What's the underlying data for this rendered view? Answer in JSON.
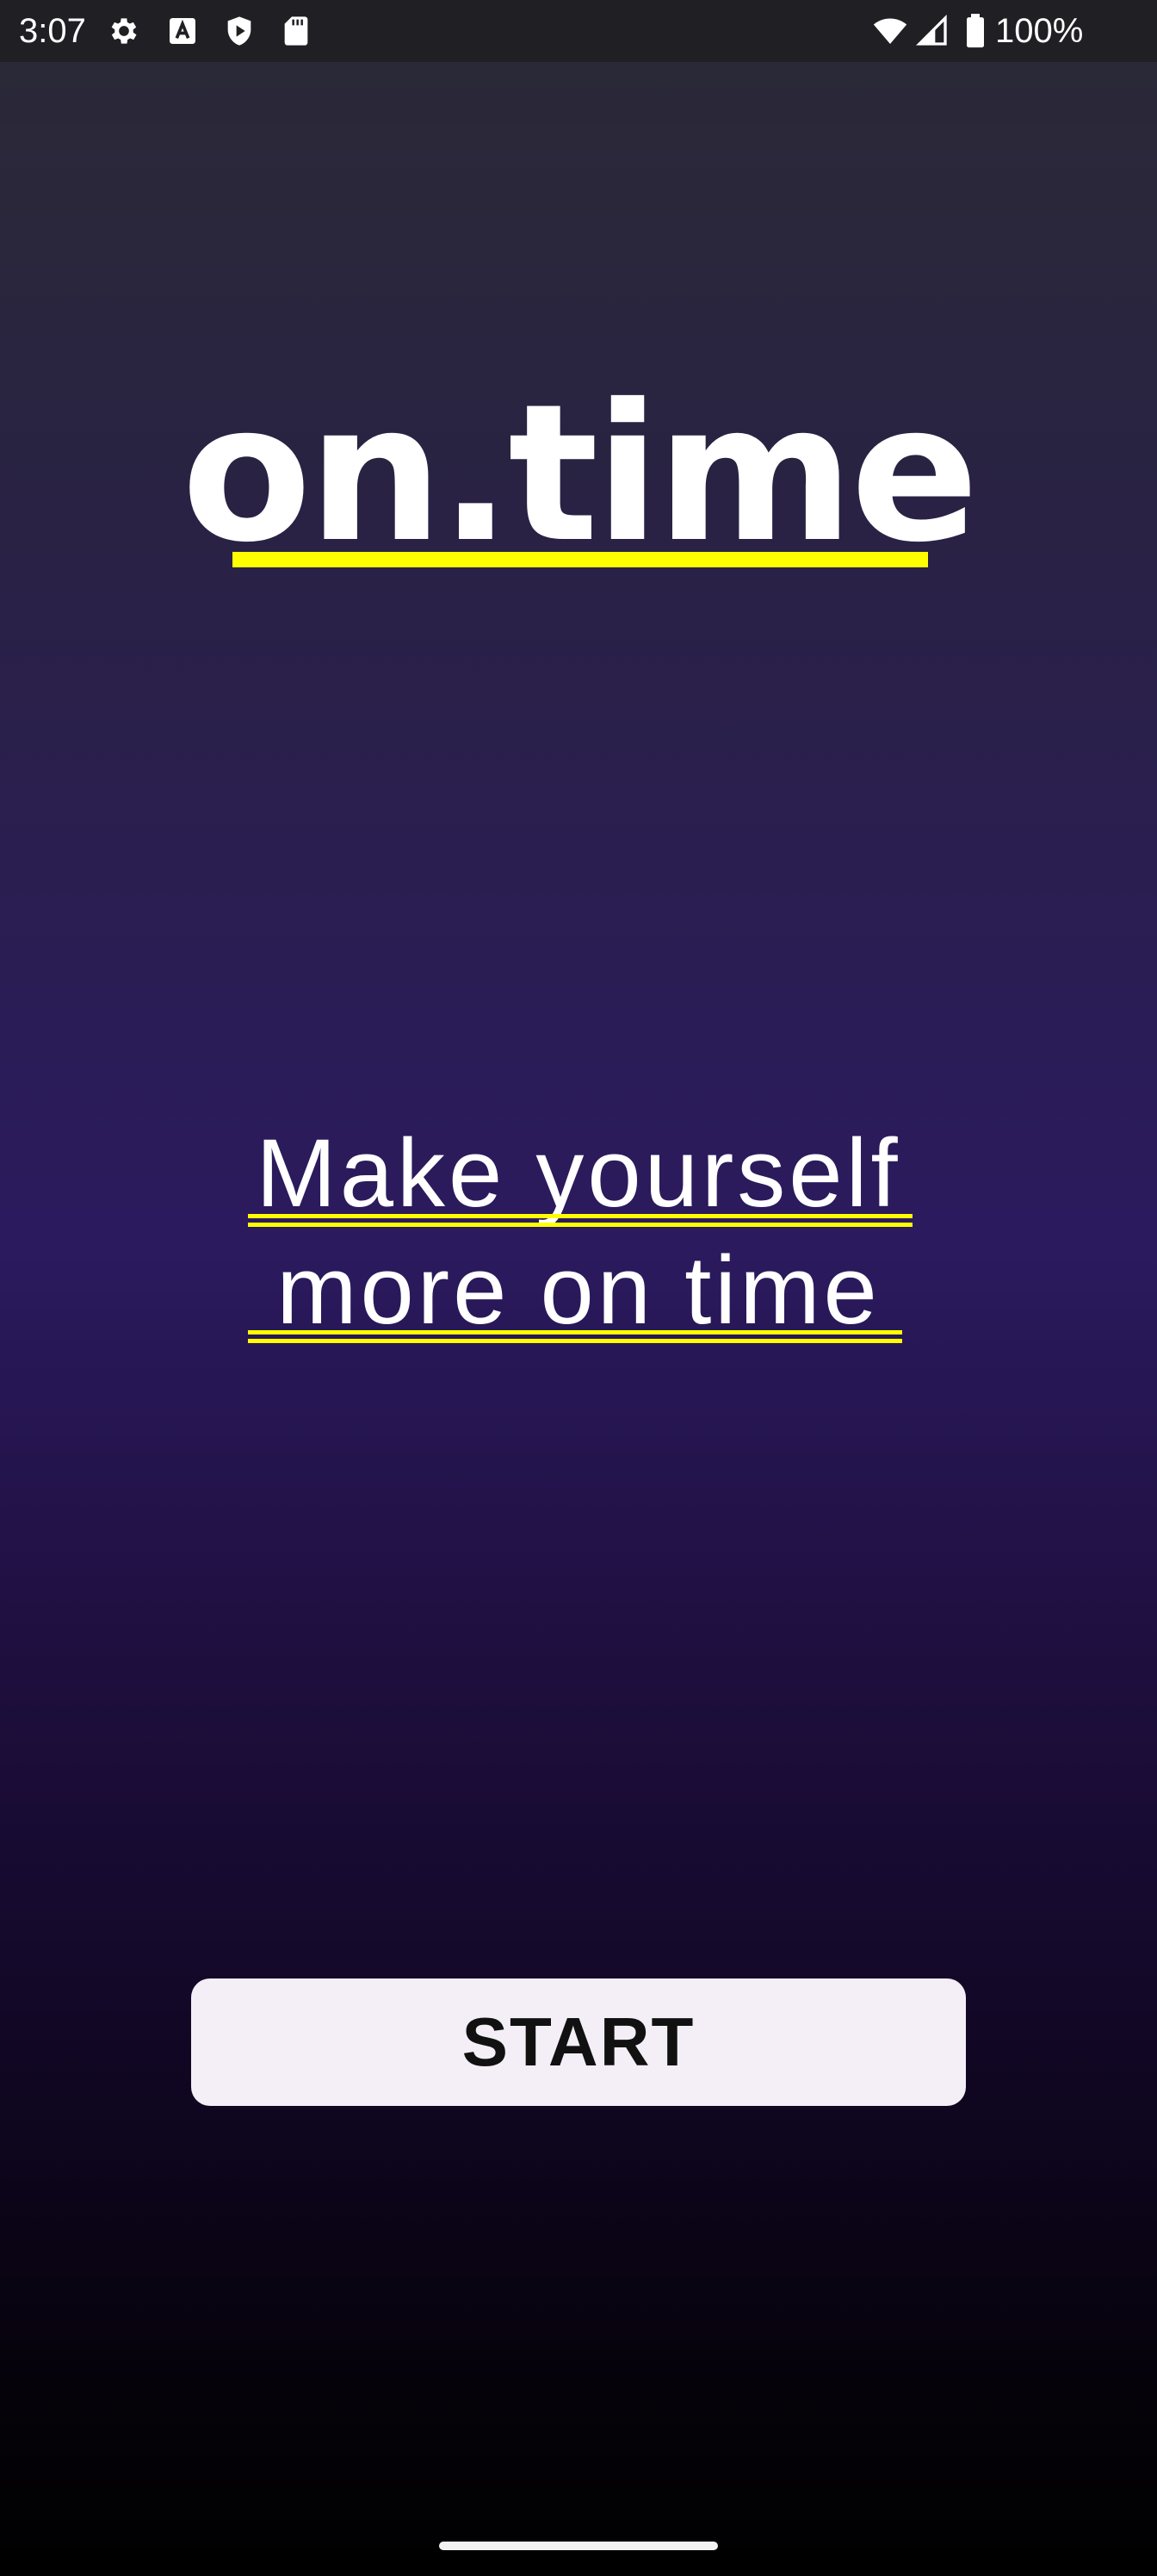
{
  "status_bar": {
    "time": "3:07",
    "battery_text": "100%",
    "icons": [
      "gear-icon",
      "a-box-icon",
      "shield-play-icon",
      "sd-card-icon",
      "wifi-icon",
      "signal-icon",
      "battery-icon"
    ]
  },
  "app": {
    "title": "on.time",
    "accent_color": "#ffff00"
  },
  "tagline": {
    "line1": "Make yourself",
    "line2": " more on time"
  },
  "start_button": {
    "label": "START"
  }
}
